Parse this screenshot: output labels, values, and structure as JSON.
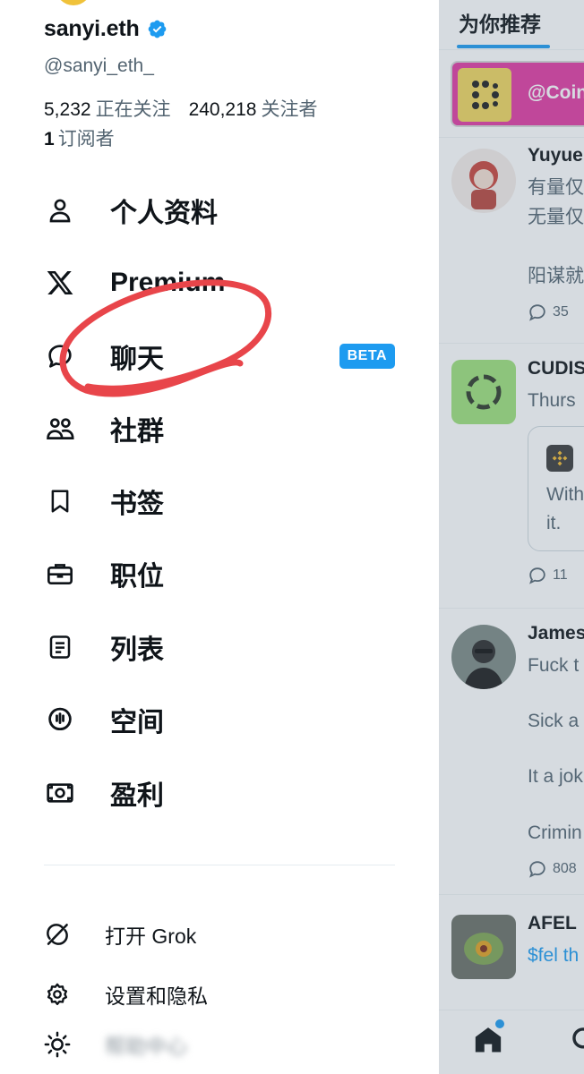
{
  "profile": {
    "display_name": "sanyi.eth",
    "handle": "@sanyi_eth_",
    "following_count": "5,232",
    "following_label": "正在关注",
    "followers_count": "240,218",
    "followers_label": "关注者",
    "subscribers_count": "1",
    "subscribers_label": "订阅者"
  },
  "menu": {
    "items": [
      {
        "label": "个人资料",
        "icon": "person-icon"
      },
      {
        "label": "Premium",
        "icon": "x-logo-icon"
      },
      {
        "label": "聊天",
        "icon": "chat-bubble-icon",
        "badge": "BETA"
      },
      {
        "label": "社群",
        "icon": "communities-icon"
      },
      {
        "label": "书签",
        "icon": "bookmark-icon"
      },
      {
        "label": "职位",
        "icon": "briefcase-icon"
      },
      {
        "label": "列表",
        "icon": "list-icon"
      },
      {
        "label": "空间",
        "icon": "spaces-mic-icon"
      },
      {
        "label": "盈利",
        "icon": "monetization-icon"
      }
    ],
    "secondary": [
      {
        "label": "打开 Grok",
        "icon": "grok-icon"
      },
      {
        "label": "设置和隐私",
        "icon": "gear-icon"
      },
      {
        "label": "帮助中心",
        "icon": "sun-icon"
      }
    ]
  },
  "feed": {
    "tab_label": "为你推荐",
    "promo_text": "@Coin",
    "posts": [
      {
        "name": "Yuyue",
        "lines": [
          "有量仅",
          "无量仅",
          "",
          "阳谋就"
        ],
        "reply_count": "35"
      },
      {
        "name": "CUDIS",
        "lines": [
          "Thurs"
        ],
        "quote_lines": [
          "With",
          "it."
        ],
        "reply_count": "11"
      },
      {
        "name": "James",
        "lines": [
          "Fuck t",
          "",
          "Sick a",
          "",
          "It a jok",
          "",
          "Crimin"
        ],
        "reply_count": "808"
      },
      {
        "name": "AFEL",
        "lines": [
          "$fel th"
        ]
      }
    ]
  },
  "colors": {
    "accent": "#1d9bf0",
    "annotation": "#e8454a",
    "text_primary": "#0f1419",
    "text_secondary": "#536471"
  }
}
